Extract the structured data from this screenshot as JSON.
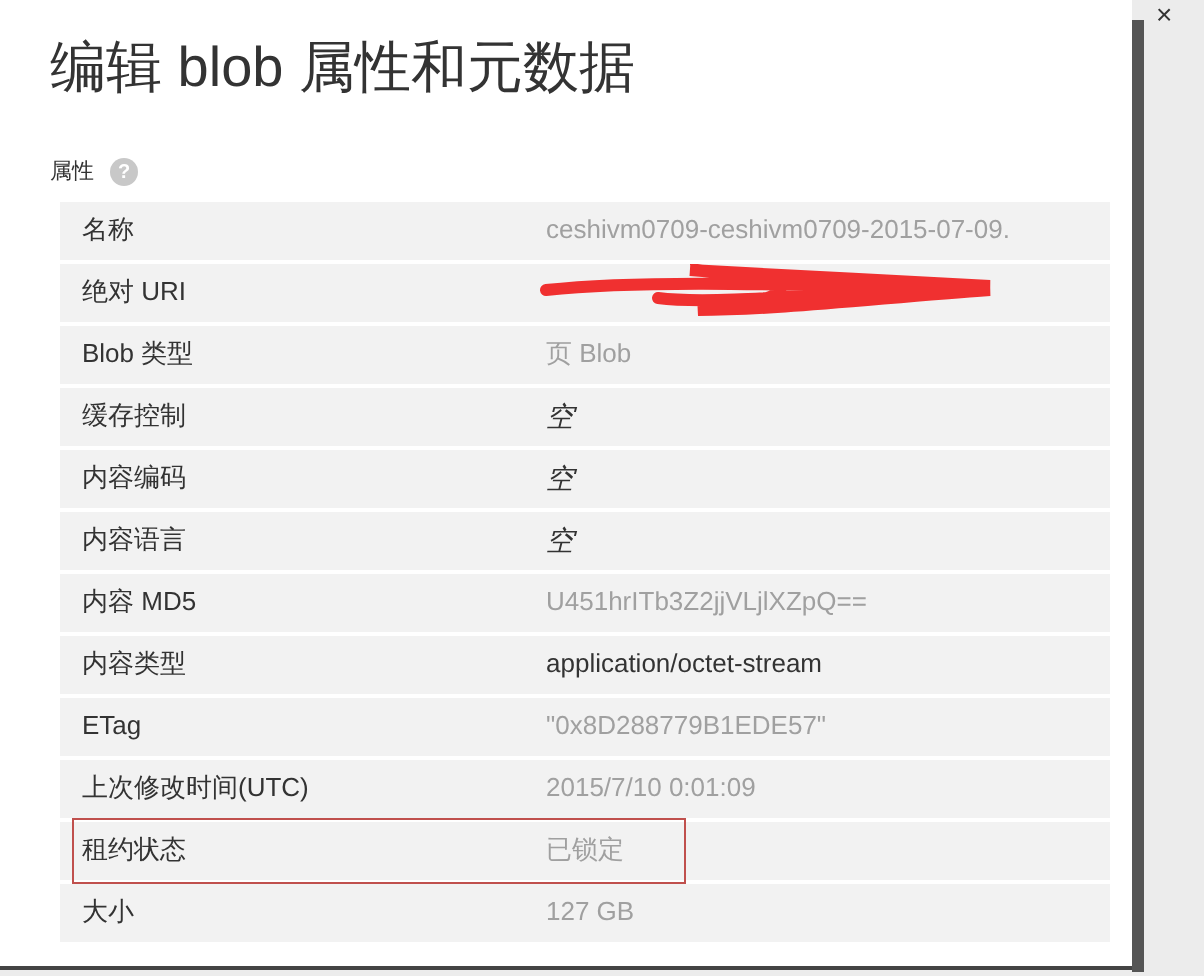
{
  "dialog": {
    "title": "编辑 blob 属性和元数据",
    "close": "×"
  },
  "section": {
    "label": "属性",
    "help": "?"
  },
  "rows": [
    {
      "label": "名称",
      "value": "ceshivm0709-ceshivm0709-2015-07-09.",
      "kind": "readonly",
      "highlighted": false
    },
    {
      "label": "绝对 URI",
      "kind": "redacted",
      "highlighted": false
    },
    {
      "label": "Blob 类型",
      "value": "页 Blob",
      "kind": "readonly",
      "highlighted": false
    },
    {
      "label": "缓存控制",
      "value": "空",
      "kind": "empty",
      "highlighted": false
    },
    {
      "label": "内容编码",
      "value": "空",
      "kind": "empty",
      "highlighted": false
    },
    {
      "label": "内容语言",
      "value": "空",
      "kind": "empty",
      "highlighted": false
    },
    {
      "label": "内容 MD5",
      "value": "U451hrITb3Z2jjVLjlXZpQ==",
      "kind": "readonly",
      "highlighted": false
    },
    {
      "label": "内容类型",
      "value": "application/octet-stream",
      "kind": "editable",
      "highlighted": false
    },
    {
      "label": "ETag",
      "value": "\"0x8D288779B1EDE57\"",
      "kind": "readonly",
      "highlighted": false
    },
    {
      "label": "上次修改时间(UTC)",
      "value": "2015/7/10 0:01:09",
      "kind": "readonly",
      "highlighted": false
    },
    {
      "label": "租约状态",
      "value": "已锁定",
      "kind": "readonly",
      "highlighted": true
    },
    {
      "label": "大小",
      "value": "127 GB",
      "kind": "readonly",
      "highlighted": false
    }
  ]
}
